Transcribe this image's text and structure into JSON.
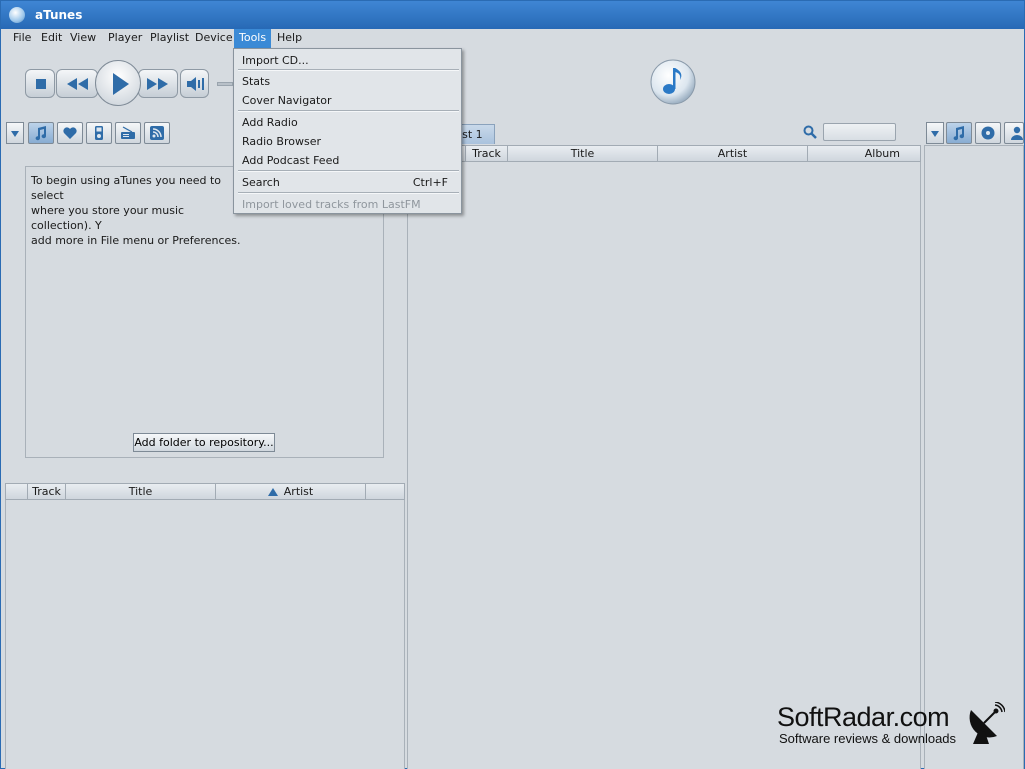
{
  "window": {
    "title": "aTunes"
  },
  "menubar": {
    "items": [
      {
        "label": "File"
      },
      {
        "label": "Edit"
      },
      {
        "label": "View"
      },
      {
        "label": "Player"
      },
      {
        "label": "Playlist"
      },
      {
        "label": "Device"
      },
      {
        "label": "Tools"
      },
      {
        "label": "Help"
      }
    ],
    "active": "Tools"
  },
  "tools_menu": {
    "items": [
      {
        "label": "Import CD..."
      },
      {
        "label": "Stats"
      },
      {
        "label": "Cover Navigator"
      },
      {
        "label": "Add Radio"
      },
      {
        "label": "Radio Browser"
      },
      {
        "label": "Add Podcast Feed"
      },
      {
        "label": "Search",
        "shortcut": "Ctrl+F"
      },
      {
        "label": "Import loved tracks from LastFM",
        "disabled": true
      }
    ]
  },
  "navigator": {
    "info_text": "To begin using aTunes you need to select where you store your music collection). You can add more in File menu or Preferences.",
    "info_lines": [
      "To begin using aTunes you need to select",
      "where you store your music collection). Y",
      "add more in File menu or Preferences."
    ],
    "add_folder_label": "Add folder to repository...",
    "table_columns": [
      "Track",
      "Title",
      "Artist"
    ]
  },
  "playlist": {
    "tab_label": "list 1",
    "columns": [
      "Track",
      "Title",
      "Artist",
      "Album"
    ]
  },
  "watermark": {
    "name": "SoftRadar.com",
    "tagline": "Software reviews & downloads"
  },
  "colors": {
    "accent": "#2f6ca8",
    "menu_highlight": "#3b8ad6",
    "titlebar": "#2769b5"
  },
  "icons": {
    "toolbar": [
      "stop-icon",
      "previous-icon",
      "play-icon",
      "next-icon",
      "volume-icon"
    ],
    "navigator_tabs": [
      "music-note-icon",
      "heart-icon",
      "device-icon",
      "radio-icon",
      "rss-icon"
    ],
    "context_tabs": [
      "music-note-icon",
      "disc-icon",
      "person-icon"
    ]
  }
}
